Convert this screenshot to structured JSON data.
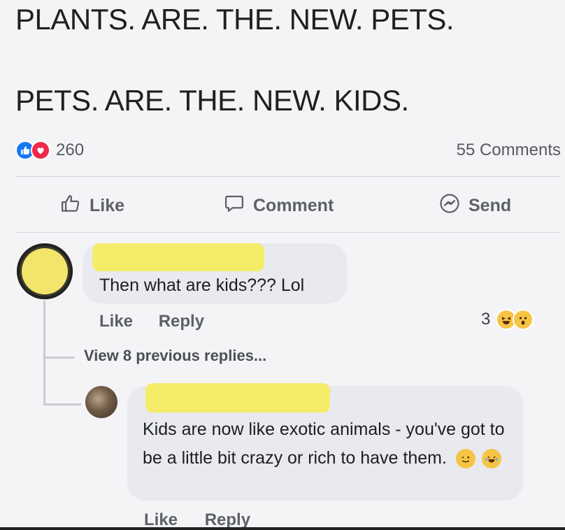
{
  "post": {
    "line1": "PLANTS. ARE. THE. NEW. PETS.",
    "line2": "PETS. ARE. THE. NEW. KIDS."
  },
  "stats": {
    "reaction_count": "260",
    "comments_label": "55 Comments",
    "reactions": [
      "like-icon",
      "love-icon"
    ]
  },
  "actions": {
    "like": "Like",
    "comment": "Comment",
    "send": "Send"
  },
  "comment1": {
    "text": "Then what are kids??? Lol",
    "like": "Like",
    "reply": "Reply",
    "reaction_count": "3",
    "reactions": [
      "laughing-emoji",
      "surprised-emoji"
    ]
  },
  "thread": {
    "view_replies": "View 8 previous replies..."
  },
  "comment2": {
    "text": "Kids are now like exotic animals - you've got to be a little bit crazy or rich to have them.",
    "inline_emojis": [
      "winking-emoji",
      "tears-of-joy-emoji"
    ],
    "like": "Like",
    "reply": "Reply"
  },
  "colors": {
    "like_blue": "#1877f2",
    "love_red": "#f0284a",
    "redaction_yellow": "#f5ec6a",
    "bubble_gray": "#e9eaef"
  }
}
